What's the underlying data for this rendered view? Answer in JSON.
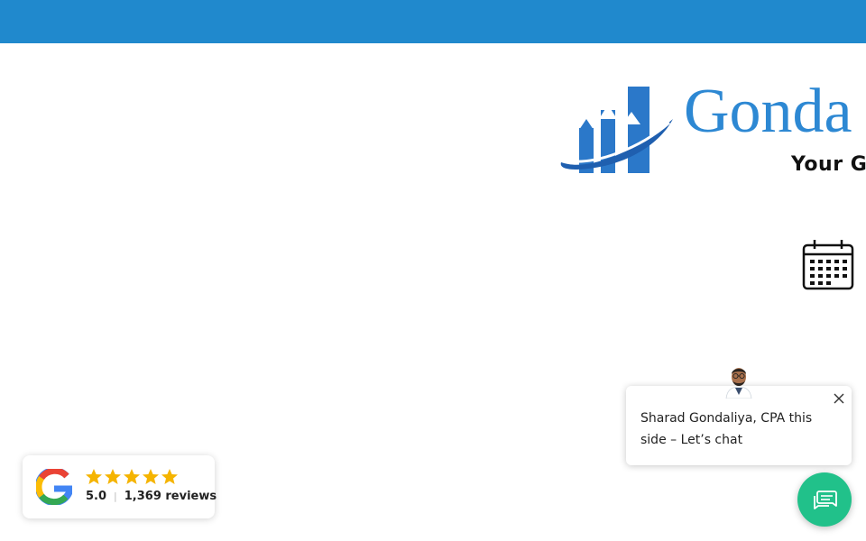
{
  "header": {
    "bar_color": "#2089cd"
  },
  "logo": {
    "wordmark": "Gonda",
    "tagline": "Your G",
    "icon": "rising-bar-chart-logo-icon"
  },
  "calendar": {
    "icon": "calendar-icon"
  },
  "chat": {
    "message": "Sharad Gondaliya, CPA this side – Let’s chat",
    "avatar_icon": "agent-avatar",
    "close_icon": "close-icon",
    "launcher_icon": "chat-bubble-icon",
    "launcher_color": "#21c18a"
  },
  "reviews": {
    "provider_icon": "google-g-icon",
    "stars_filled": 5,
    "stars_total": 5,
    "rating": "5.0",
    "separator": "|",
    "count_text": "1,369 reviews",
    "star_color": "#f5b400"
  }
}
